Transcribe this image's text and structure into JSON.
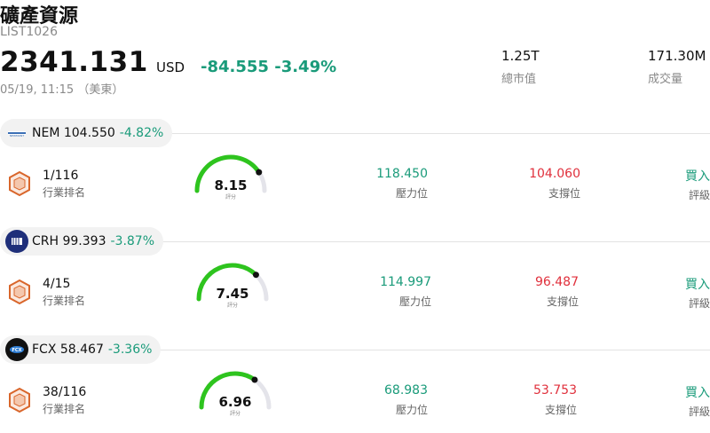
{
  "header": {
    "title": "礦產資源",
    "code": "LIST1026",
    "price": "2341.131",
    "currency": "USD",
    "change": "-84.555",
    "change_pct": "-3.49%",
    "timestamp": "05/19, 11:15 （美東）",
    "market_cap_value": "1.25T",
    "market_cap_label": "總市值",
    "volume_value": "171.30M",
    "volume_label": "成交量"
  },
  "colors": {
    "up": "#1a9b7a",
    "down": "#e0303c",
    "gauge": "#2ec41e",
    "hex": "#d9662b"
  },
  "labels": {
    "rank": "行業排名",
    "score": "評分",
    "resistance": "壓力位",
    "support": "支撐位",
    "rating": "評級"
  },
  "stocks": [
    {
      "symbol": "NEM",
      "price": "104.550",
      "change_pct": "-4.82%",
      "rank": "1/116",
      "score": 8.15,
      "resistance": "118.450",
      "support": "104.060",
      "rating": "買入",
      "logo": "nem-logo-icon"
    },
    {
      "symbol": "CRH",
      "price": "99.393",
      "change_pct": "-3.87%",
      "rank": "4/15",
      "score": 7.45,
      "resistance": "114.997",
      "support": "96.487",
      "rating": "買入",
      "logo": "crh-logo-icon"
    },
    {
      "symbol": "FCX",
      "price": "58.467",
      "change_pct": "-3.36%",
      "rank": "38/116",
      "score": 6.96,
      "resistance": "68.983",
      "support": "53.753",
      "rating": "買入",
      "logo": "fcx-logo-icon"
    }
  ]
}
